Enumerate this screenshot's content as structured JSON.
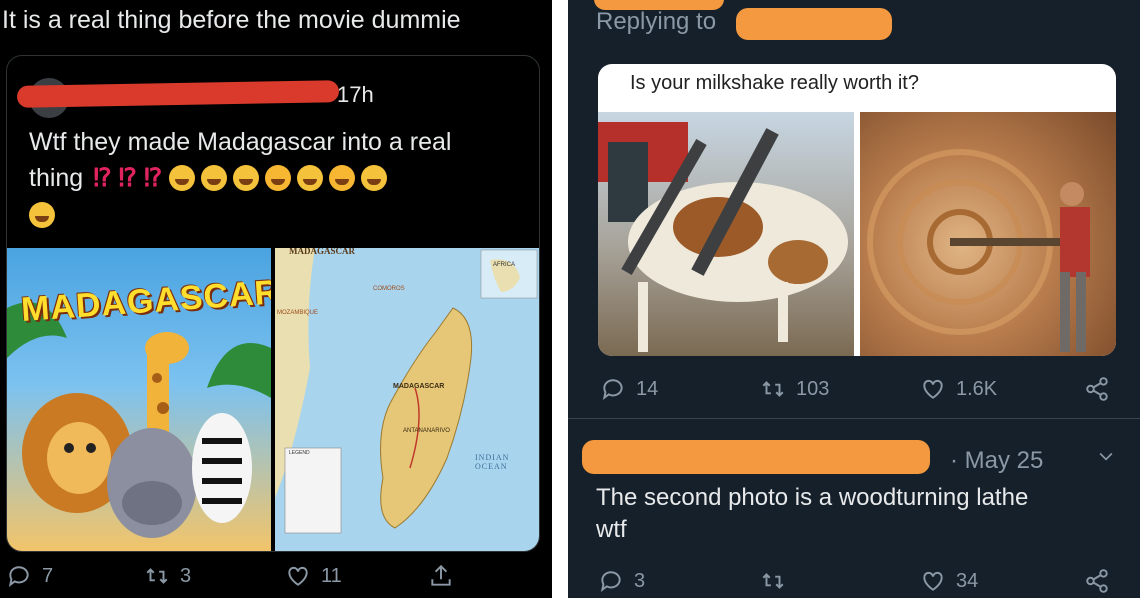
{
  "left": {
    "top_text": "It is a real thing before the movie dummie",
    "quote": {
      "time": "17h",
      "text_line1": "Wtf they made Madagascar into a real",
      "text_line2_word": "thing",
      "exclaims": [
        "⁉",
        "⁉",
        "⁉"
      ],
      "movie_poster_title": "MADAGASCAR",
      "map_title": "MADAGASCAR",
      "map_label_center": "MADAGASCAR",
      "map_label_ocean": "INDIAN OCEAN",
      "map_label_region": "AFRICA",
      "map_label_capital": "ANTANANARIVO",
      "map_label_islands": "COMOROS",
      "map_label_channel": "MOZAMBIQUE",
      "map_label_legend": "LEGEND"
    },
    "actions": {
      "replies": "7",
      "retweets": "3",
      "likes": "11"
    }
  },
  "right": {
    "replying_to": "Replying to",
    "quoted_image_caption": "Is your milkshake really worth it?",
    "actions1": {
      "replies": "14",
      "retweets": "103",
      "likes": "1.6K"
    },
    "reply_date": "· May 25",
    "reply_text_line1": "The second photo is a woodturning lathe",
    "reply_text_line2": "wtf",
    "actions2": {
      "replies": "3",
      "likes": "34"
    }
  },
  "colors": {
    "accent_red": "#e0245e",
    "redaction_left": "#d93a2b",
    "redaction_right": "#f4993f"
  }
}
